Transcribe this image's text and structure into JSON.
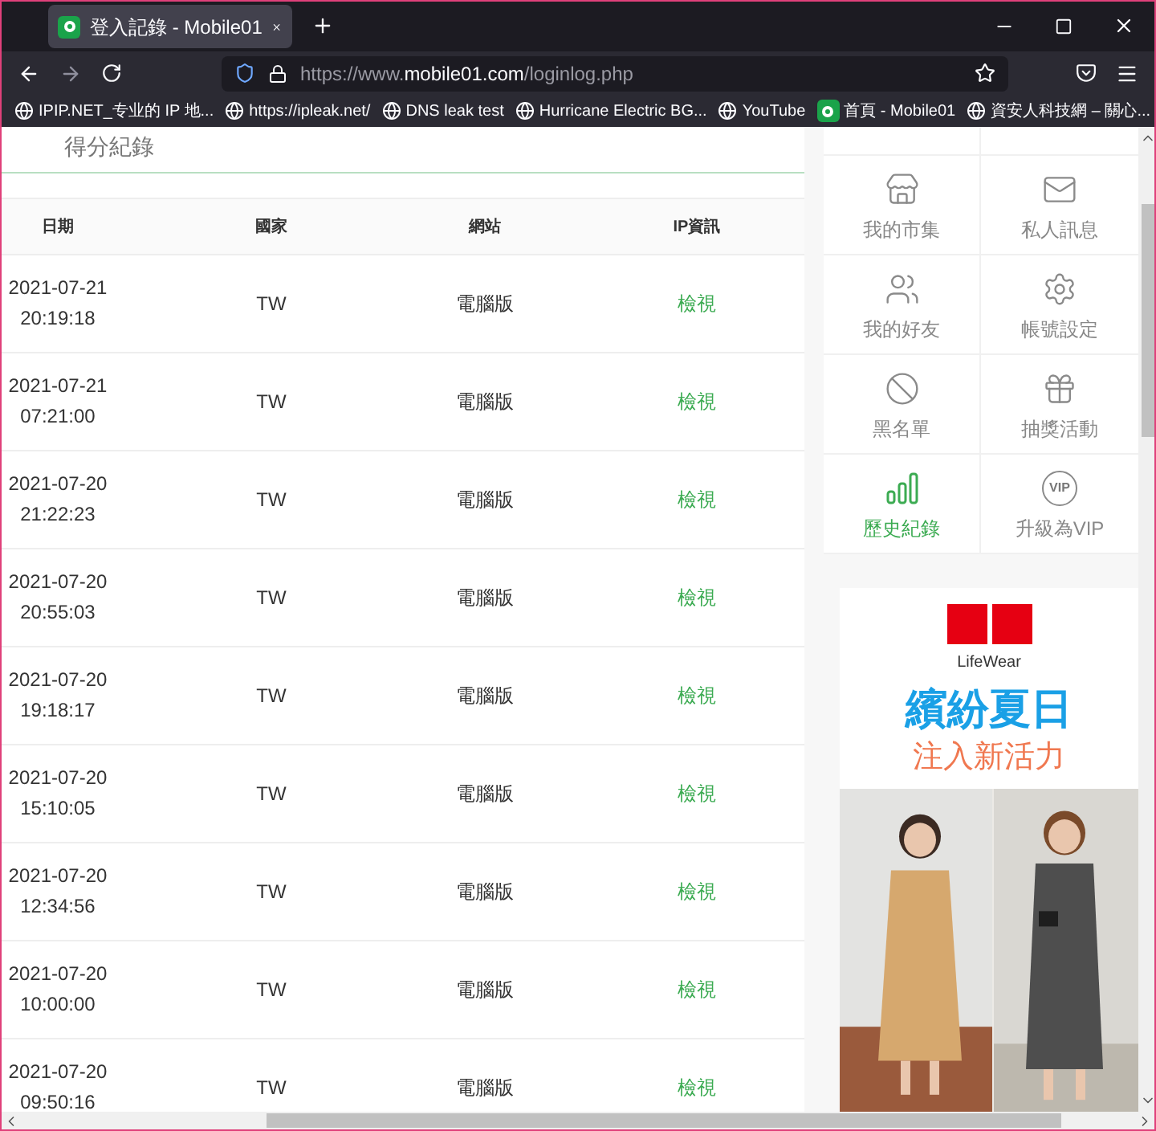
{
  "browser": {
    "tab": {
      "title": "登入記錄 - Mobile01",
      "selected": true
    },
    "url": {
      "scheme": "https://www.",
      "domain": "mobile01.com",
      "path": "/loginlog.php"
    },
    "bookmarks": [
      {
        "label": "IPIP.NET_专业的 IP 地...",
        "kind": "globe"
      },
      {
        "label": "https://ipleak.net/",
        "kind": "globe"
      },
      {
        "label": "DNS leak test",
        "kind": "globe"
      },
      {
        "label": "Hurricane Electric BG...",
        "kind": "globe"
      },
      {
        "label": "YouTube",
        "kind": "globe"
      },
      {
        "label": "首頁 - Mobile01",
        "kind": "site"
      },
      {
        "label": "資安人科技網 – 關心...",
        "kind": "globe"
      }
    ]
  },
  "page": {
    "heading": "得分紀錄",
    "table": {
      "columns": [
        "日期",
        "國家",
        "網站",
        "IP資訊"
      ],
      "rows": [
        {
          "date": "2021-07-21",
          "time": "20:19:18",
          "country": "TW",
          "site": "電腦版",
          "ip": "檢視"
        },
        {
          "date": "2021-07-21",
          "time": "07:21:00",
          "country": "TW",
          "site": "電腦版",
          "ip": "檢視"
        },
        {
          "date": "2021-07-20",
          "time": "21:22:23",
          "country": "TW",
          "site": "電腦版",
          "ip": "檢視"
        },
        {
          "date": "2021-07-20",
          "time": "20:55:03",
          "country": "TW",
          "site": "電腦版",
          "ip": "檢視"
        },
        {
          "date": "2021-07-20",
          "time": "19:18:17",
          "country": "TW",
          "site": "電腦版",
          "ip": "檢視"
        },
        {
          "date": "2021-07-20",
          "time": "15:10:05",
          "country": "TW",
          "site": "電腦版",
          "ip": "檢視"
        },
        {
          "date": "2021-07-20",
          "time": "12:34:56",
          "country": "TW",
          "site": "電腦版",
          "ip": "檢視"
        },
        {
          "date": "2021-07-20",
          "time": "10:00:00",
          "country": "TW",
          "site": "電腦版",
          "ip": "檢視"
        },
        {
          "date": "2021-07-20",
          "time": "09:50:16",
          "country": "TW",
          "site": "電腦版",
          "ip": "檢視"
        }
      ]
    }
  },
  "sidebar": {
    "items": [
      {
        "label": "我的市集",
        "kind": "store",
        "selected": false
      },
      {
        "label": "私人訊息",
        "kind": "mail",
        "selected": false
      },
      {
        "label": "我的好友",
        "kind": "friends",
        "selected": false
      },
      {
        "label": "帳號設定",
        "kind": "gear",
        "selected": false
      },
      {
        "label": "黑名單",
        "kind": "ban",
        "selected": false
      },
      {
        "label": "抽獎活動",
        "kind": "gift",
        "selected": false
      },
      {
        "label": "歷史紀錄",
        "kind": "bars",
        "selected": true
      },
      {
        "label": "升級為VIP",
        "kind": "vip",
        "selected": false
      }
    ],
    "vip_badge_text": "VIP",
    "ad": {
      "tagline": "LifeWear",
      "headline": "繽紛夏日",
      "subhead": "注入新活力"
    }
  }
}
